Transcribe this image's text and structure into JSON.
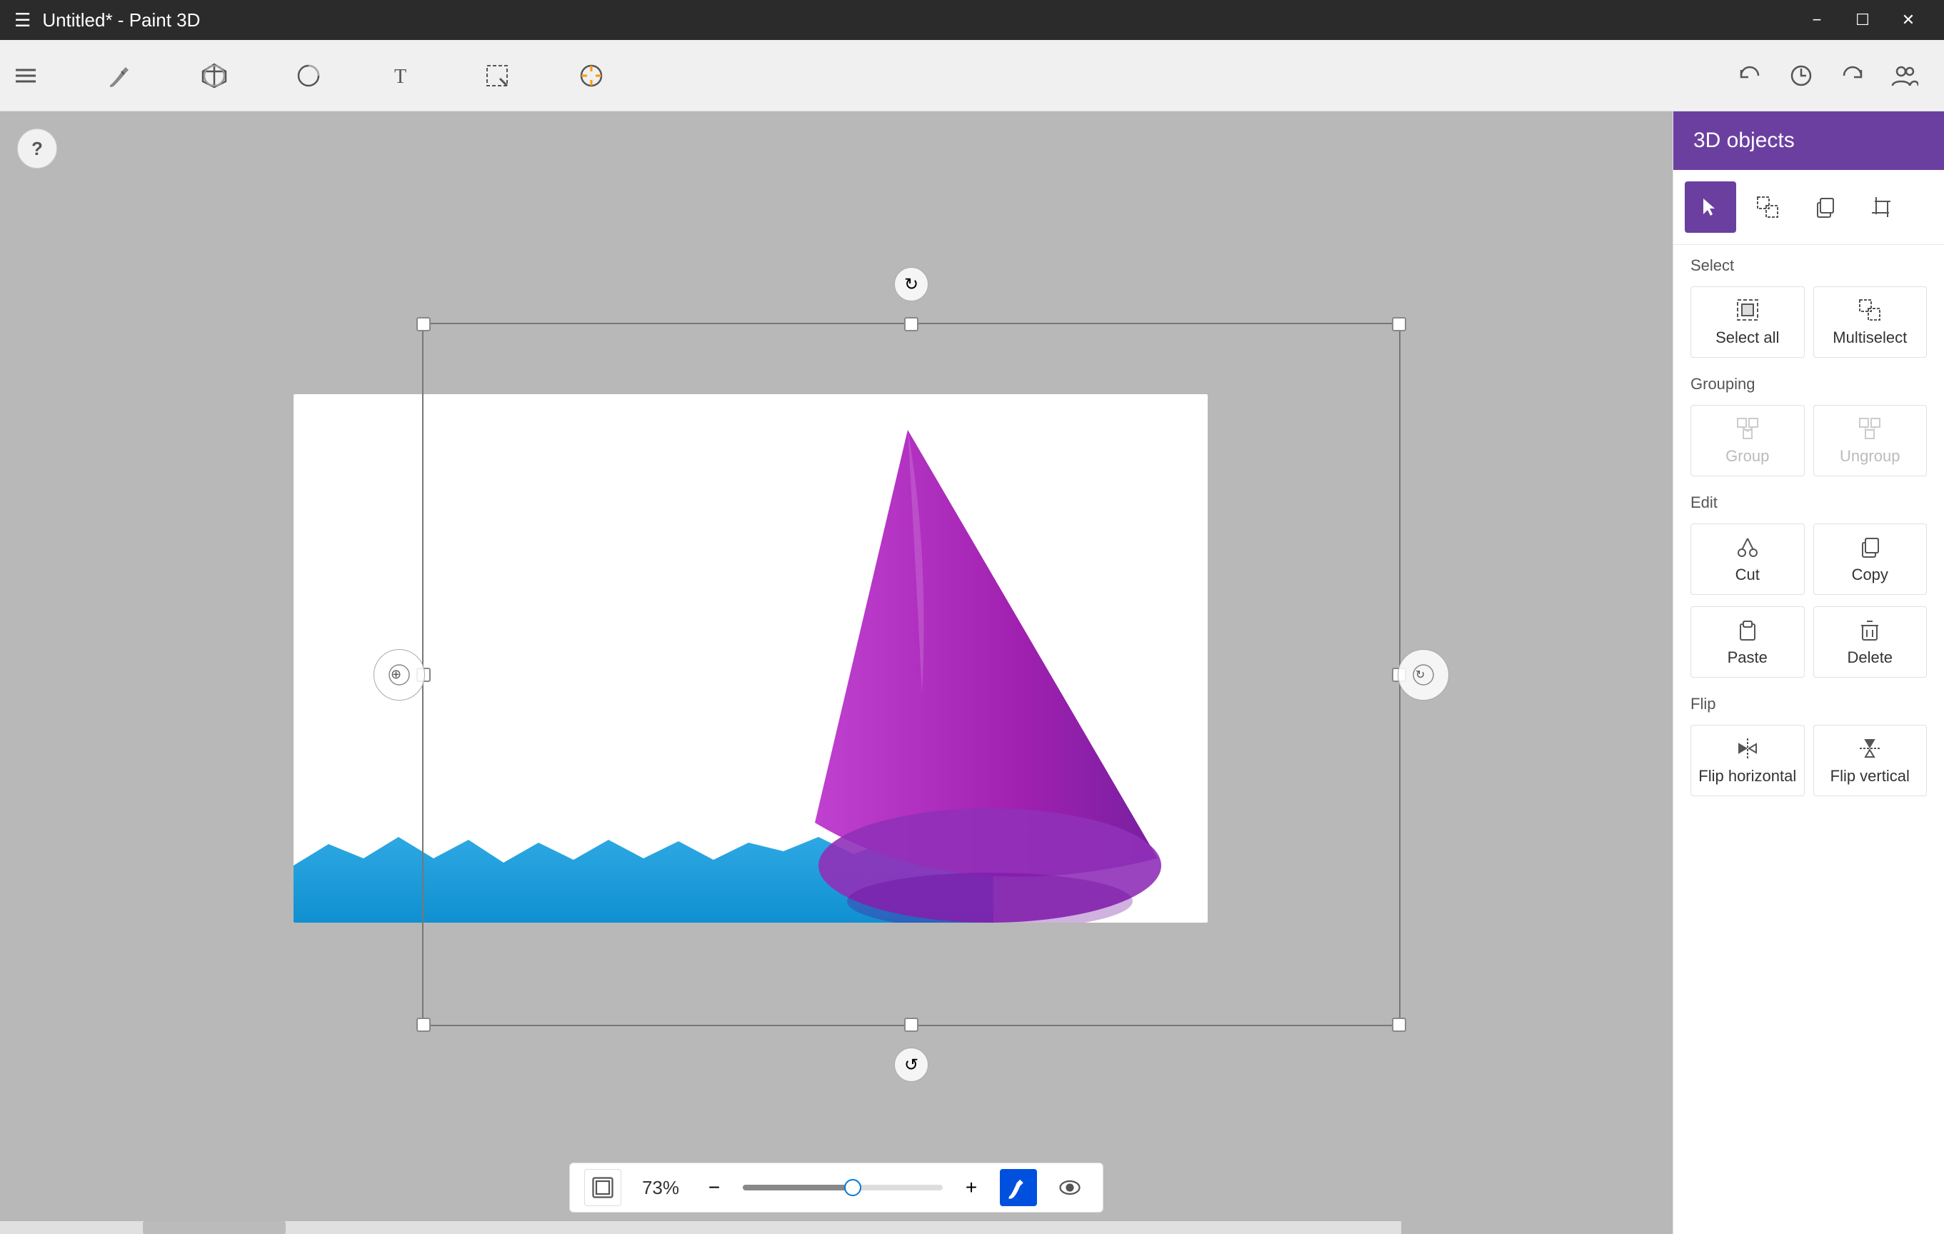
{
  "titleBar": {
    "title": "Untitled* - Paint 3D",
    "minimizeLabel": "Minimize",
    "maximizeLabel": "Maximize",
    "closeLabel": "Close"
  },
  "toolbar": {
    "items": [
      {
        "id": "menu",
        "label": "Menu",
        "icon": "menu"
      },
      {
        "id": "brushes",
        "label": "Brushes",
        "icon": "brush"
      },
      {
        "id": "3d-shapes",
        "label": "3D shapes",
        "icon": "cube"
      },
      {
        "id": "2d-shapes",
        "label": "2D shapes",
        "icon": "circle"
      },
      {
        "id": "text",
        "label": "Text",
        "icon": "text"
      },
      {
        "id": "select",
        "label": "Select",
        "icon": "select"
      },
      {
        "id": "effects",
        "label": "Effects",
        "icon": "effects"
      }
    ],
    "rightIcons": [
      {
        "id": "undo",
        "label": "Undo"
      },
      {
        "id": "history",
        "label": "History"
      },
      {
        "id": "redo",
        "label": "Redo"
      },
      {
        "id": "people",
        "label": "People"
      }
    ]
  },
  "canvas": {
    "zoomPercent": "73%"
  },
  "panel": {
    "title": "3D objects",
    "tools": [
      {
        "id": "select-tool",
        "label": "Select",
        "active": true
      },
      {
        "id": "magic-select",
        "label": "Magic select",
        "active": false
      },
      {
        "id": "copy-paste",
        "label": "Copy paste",
        "active": false
      },
      {
        "id": "crop",
        "label": "Crop",
        "active": false
      }
    ],
    "sections": [
      {
        "label": "Select",
        "buttons": [
          {
            "id": "select-all",
            "label": "Select all",
            "disabled": false
          },
          {
            "id": "multiselect",
            "label": "Multiselect",
            "disabled": false
          }
        ]
      },
      {
        "label": "Grouping",
        "buttons": [
          {
            "id": "group",
            "label": "Group",
            "disabled": true
          },
          {
            "id": "ungroup",
            "label": "Ungroup",
            "disabled": true
          }
        ]
      },
      {
        "label": "Edit",
        "buttons": [
          {
            "id": "cut",
            "label": "Cut",
            "disabled": false
          },
          {
            "id": "copy",
            "label": "Copy",
            "disabled": false
          },
          {
            "id": "paste",
            "label": "Paste",
            "disabled": false
          },
          {
            "id": "delete",
            "label": "Delete",
            "disabled": false
          }
        ]
      },
      {
        "label": "Flip",
        "buttons": [
          {
            "id": "flip-horizontal",
            "label": "Flip horizontal",
            "disabled": false
          },
          {
            "id": "flip-vertical",
            "label": "Flip vertical",
            "disabled": false
          }
        ]
      }
    ]
  },
  "statusBar": {
    "zoomPercent": "73%",
    "zoomOutLabel": "Zoom out",
    "zoomInLabel": "Zoom in"
  },
  "help": {
    "label": "?"
  }
}
